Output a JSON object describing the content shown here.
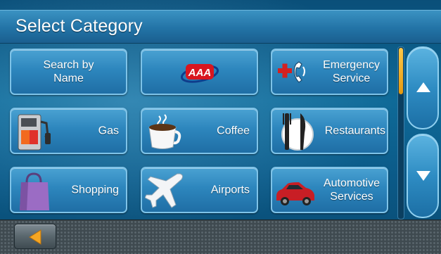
{
  "header": {
    "title": "Select Category"
  },
  "tiles": [
    {
      "line1": "Search by",
      "line2": "Name"
    },
    {
      "logo_text": "AAA"
    },
    {
      "line1": "Emergency",
      "line2": "Service"
    },
    {
      "label": "Gas"
    },
    {
      "label": "Coffee"
    },
    {
      "label": "Restaurants"
    },
    {
      "label": "Shopping"
    },
    {
      "label": "Airports"
    },
    {
      "line1": "Automotive",
      "line2": "Services"
    }
  ],
  "scroll": {
    "position": 0.0,
    "visible_fraction": 0.27
  },
  "colors": {
    "accent": "#f5a623",
    "tile_top": "#4aa2d2",
    "tile_bottom": "#1f6ea5",
    "title_bar": "#2273a6"
  },
  "icons": [
    "aaa-logo",
    "emergency-phone-icon",
    "gas-pump-icon",
    "coffee-cup-icon",
    "fork-knife-icon",
    "shopping-bag-icon",
    "airplane-icon",
    "car-icon",
    "scroll-up-icon",
    "scroll-down-icon",
    "back-arrow-icon"
  ]
}
